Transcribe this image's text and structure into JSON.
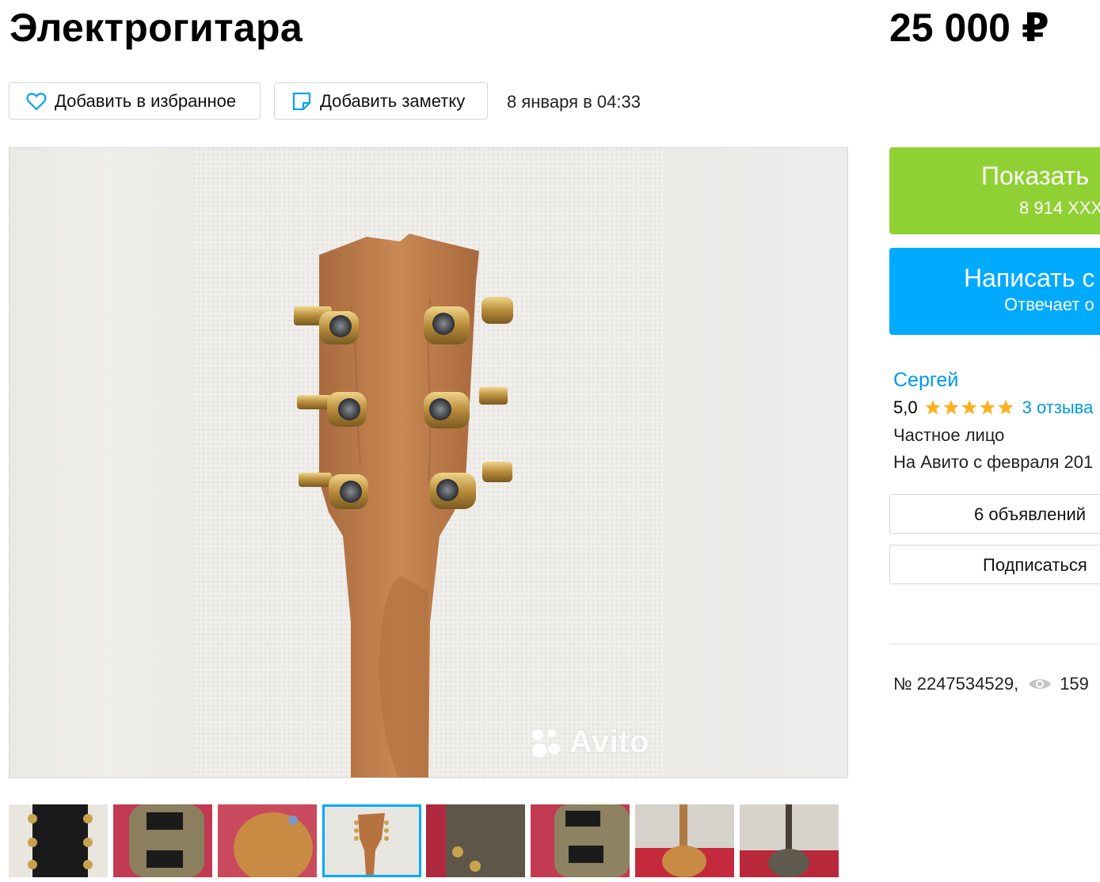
{
  "listing": {
    "title": "Электрогитара",
    "price": "25 000 ₽",
    "date": "8 января в 04:33",
    "number": "№ 2247534529,",
    "views": "159"
  },
  "actions": {
    "favorite_label": "Добавить в избранное",
    "note_label": "Добавить заметку"
  },
  "gallery": {
    "watermark": "Avito",
    "thumbnail_count": 8,
    "active_thumbnail": 4
  },
  "contact": {
    "phone_button_label": "Показать",
    "phone_masked": "8 914 XXX",
    "message_button_label": "Написать с",
    "message_subtext": "Отвечает о"
  },
  "seller": {
    "name": "Сергей",
    "rating": "5,0",
    "stars": 5,
    "reviews": "3 отзыва",
    "type": "Частное лицо",
    "since": "На Авито с февраля 201",
    "ads_button": "6 объявлений",
    "subscribe_button": "Подписаться"
  },
  "colors": {
    "green_button": "#8fd133",
    "blue_button": "#00aaff",
    "link": "#0099e6",
    "star": "#ffb021"
  }
}
